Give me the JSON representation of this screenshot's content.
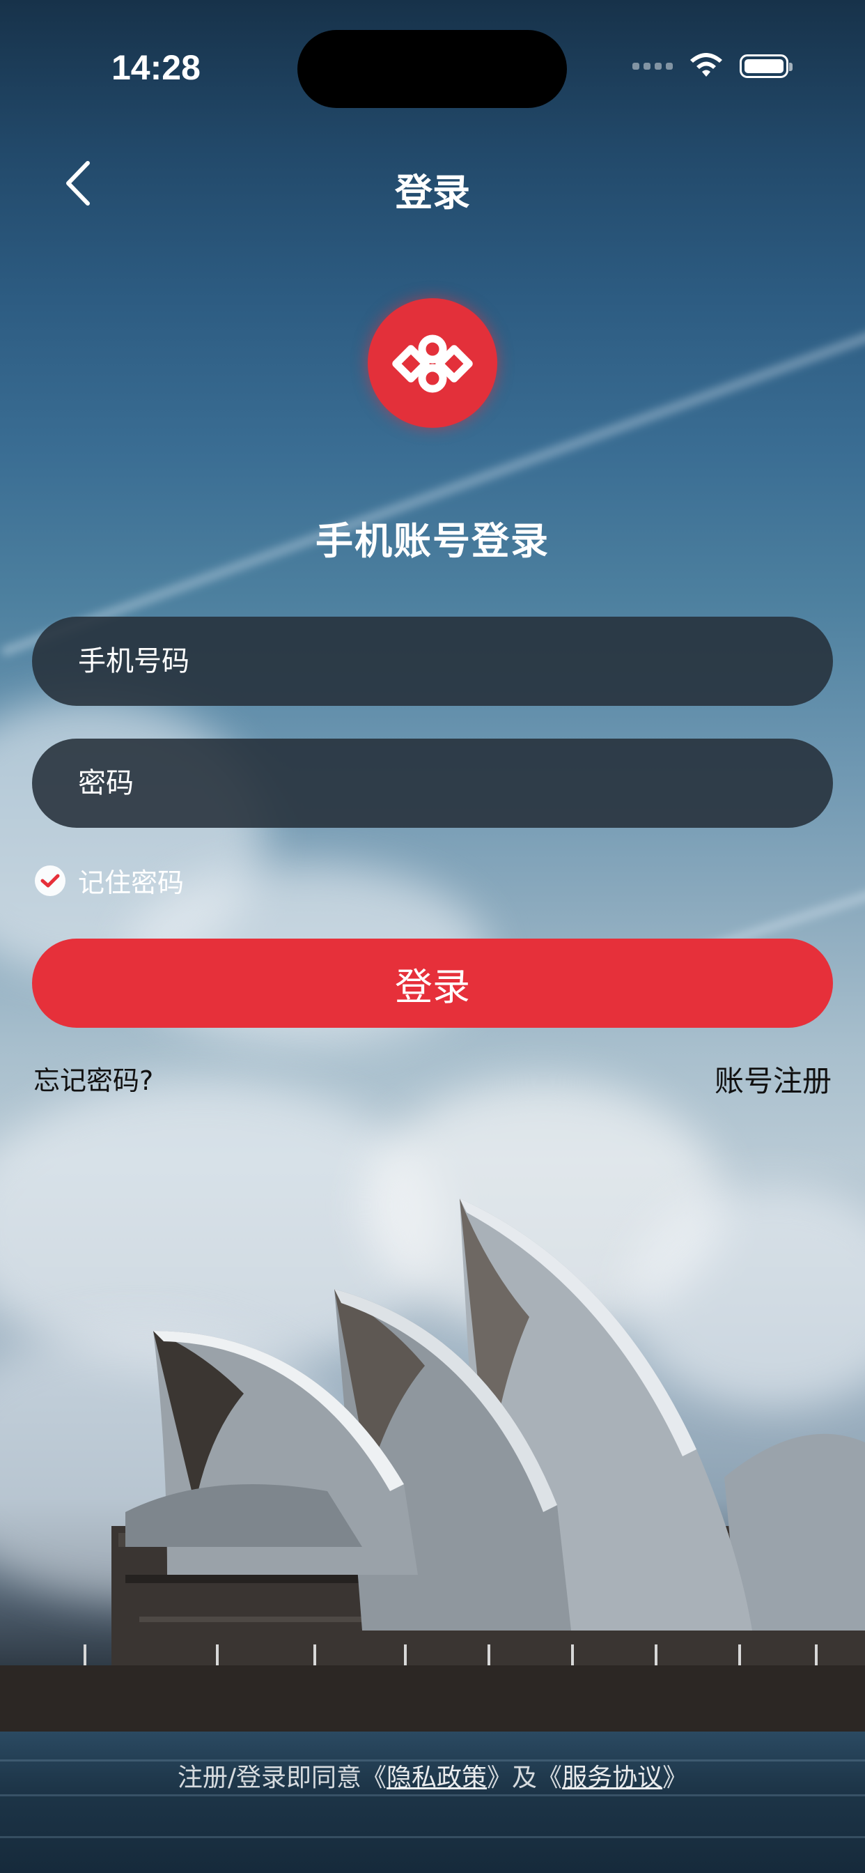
{
  "status_bar": {
    "time": "14:28"
  },
  "nav": {
    "title": "登录"
  },
  "login": {
    "heading": "手机账号登录",
    "phone_placeholder": "手机号码",
    "password_placeholder": "密码",
    "remember_label": "记住密码",
    "remember_checked": true,
    "submit_label": "登录",
    "forgot_label": "忘记密码?",
    "register_label": "账号注册"
  },
  "agreement": {
    "prefix": "注册/登录即同意《",
    "privacy": "隐私政策",
    "middle": "》及《",
    "service": "服务协议",
    "suffix": "》"
  },
  "colors": {
    "accent": "#e6303a",
    "field_bg": "#26303a"
  },
  "icons": [
    "back-chevron-icon",
    "wifi-icon",
    "battery-icon",
    "brand-logo-icon",
    "check-icon"
  ]
}
